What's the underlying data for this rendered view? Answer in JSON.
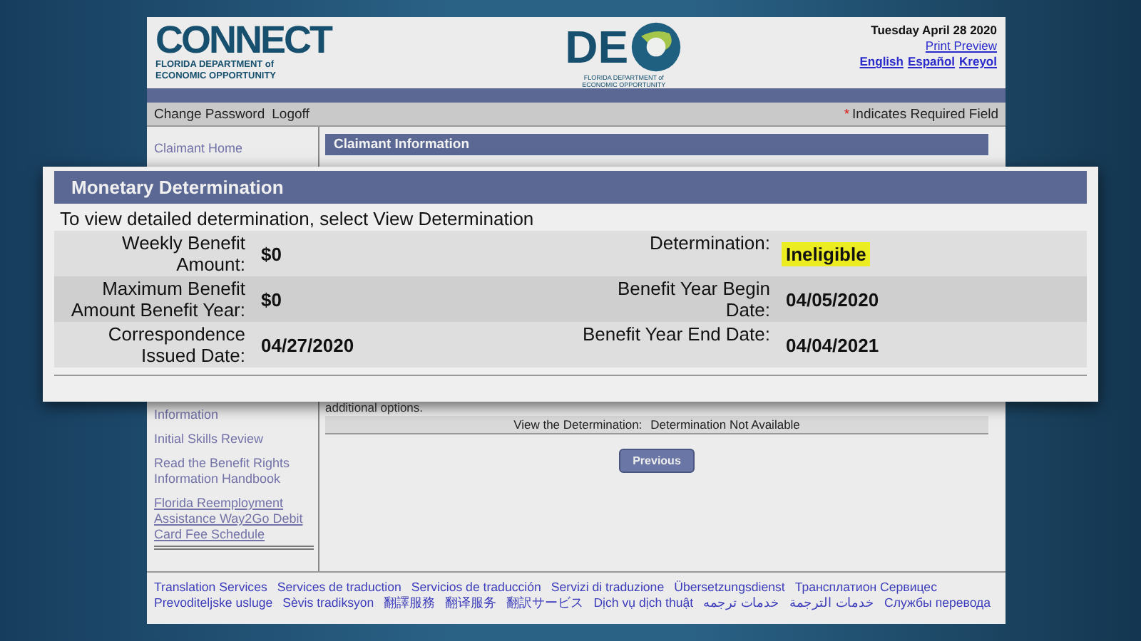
{
  "header": {
    "logo_left": {
      "word": "CONNECT",
      "subtitle": "FLORIDA DEPARTMENT of ECONOMIC OPPORTUNITY"
    },
    "logo_center": {
      "letters": "DE",
      "subtitle": "FLORIDA DEPARTMENT of ECONOMIC OPPORTUNITY"
    },
    "date": "Tuesday April 28 2020",
    "print_preview": "Print Preview",
    "languages": [
      "English",
      "Español",
      "Kreyol"
    ]
  },
  "nav": {
    "links": [
      "Change Password",
      "Logoff"
    ],
    "required_mark": "*",
    "required_note": "Indicates Required Field"
  },
  "sidebar": {
    "items": [
      {
        "label": "Claimant Home",
        "underlined": false
      },
      {
        "label": "Information",
        "underlined": false
      },
      {
        "label": "Initial Skills Review",
        "underlined": false
      },
      {
        "label": "Read the Benefit Rights Information Handbook",
        "underlined": false
      },
      {
        "label": "Florida Reemployment Assistance Way2Go Debit Card Fee Schedule",
        "underlined": true
      }
    ]
  },
  "main": {
    "section_title": "Claimant Information",
    "notice": "additional options.",
    "view_label": "View the Determination:",
    "view_value": "Determination Not Available",
    "previous_button": "Previous"
  },
  "callout": {
    "title": "Monetary Determination",
    "instruction": "To view detailed determination, select View Determination",
    "rows": [
      {
        "fields": [
          {
            "label": "Weekly Benefit Amount:",
            "value": "$0",
            "highlighted": false
          },
          {
            "label": "Determination:",
            "value": "Ineligible",
            "highlighted": true
          }
        ]
      },
      {
        "fields": [
          {
            "label": "Maximum Benefit Amount Benefit Year:",
            "value": "$0",
            "highlighted": false
          },
          {
            "label": "Benefit Year Begin Date:",
            "value": "04/05/2020",
            "highlighted": false
          }
        ]
      },
      {
        "fields": [
          {
            "label": "Correspondence Issued Date:",
            "value": "04/27/2020",
            "highlighted": false
          },
          {
            "label": "Benefit Year End Date:",
            "value": "04/04/2021",
            "highlighted": false
          }
        ]
      }
    ]
  },
  "footer": {
    "links": [
      "Translation Services",
      "Services de traduction",
      "Servicios de traducción",
      "Servizi di traduzione",
      "Übersetzungsdienst",
      "Трансплатион Сервицес",
      "Prevoditeljske usluge",
      "Sèvis tradiksyon",
      "翻譯服務",
      "翻译服务",
      "翻訳サービス",
      "Dịch vụ dịch thuật",
      "خدمات ترجمه",
      "خدمات الترجمة",
      "Службы перевода"
    ]
  }
}
